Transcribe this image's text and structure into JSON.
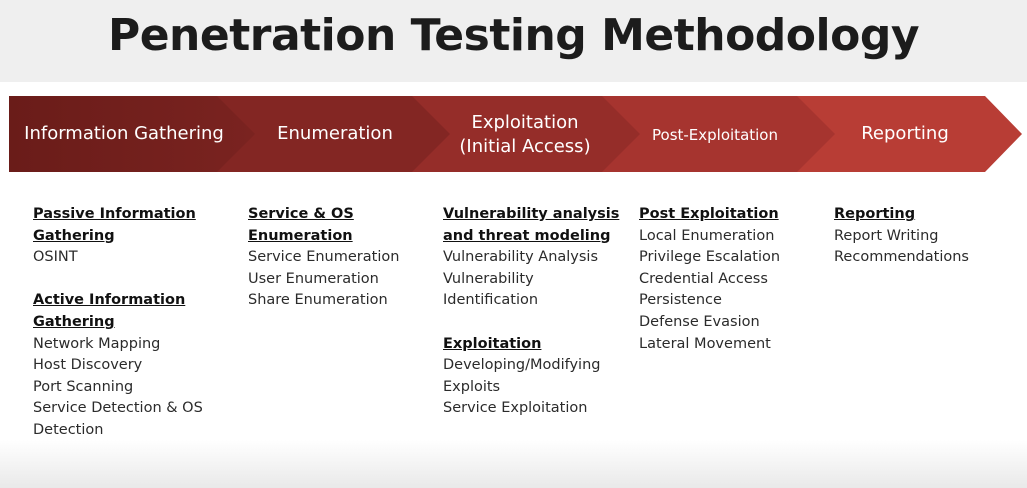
{
  "title": "Penetration Testing Methodology",
  "colors": [
    "#6e1e1b",
    "#832623",
    "#952d29",
    "#a6342f",
    "#b83d35"
  ],
  "stages": [
    {
      "label_lines": [
        "Information Gathering"
      ],
      "groups": [
        {
          "heading_lines": [
            "Passive Information",
            "Gathering"
          ],
          "items": [
            "OSINT"
          ]
        },
        {
          "heading_lines": [
            "Active Information",
            "Gathering"
          ],
          "items": [
            "Network Mapping",
            "Host Discovery",
            "Port Scanning",
            "Service Detection & OS",
            "Detection"
          ]
        }
      ]
    },
    {
      "label_lines": [
        "Enumeration"
      ],
      "groups": [
        {
          "heading_lines": [
            "Service & OS",
            "Enumeration"
          ],
          "items": [
            "Service Enumeration",
            "User Enumeration",
            "Share Enumeration"
          ]
        }
      ]
    },
    {
      "label_lines": [
        "Exploitation",
        "(Initial Access)"
      ],
      "groups": [
        {
          "heading_lines": [
            "Vulnerability analysis",
            "and threat modeling"
          ],
          "items": [
            "Vulnerability Analysis",
            "Vulnerability",
            "Identification"
          ]
        },
        {
          "heading_lines": [
            "Exploitation"
          ],
          "items": [
            "Developing/Modifying",
            "Exploits",
            "Service Exploitation"
          ]
        }
      ]
    },
    {
      "label_lines": [
        "Post-Exploitation"
      ],
      "groups": [
        {
          "heading_lines": [
            "Post Exploitation"
          ],
          "items": [
            "Local Enumeration",
            "Privilege Escalation",
            "Credential Access",
            "Persistence",
            "Defense Evasion",
            "Lateral Movement"
          ]
        }
      ]
    },
    {
      "label_lines": [
        "Reporting"
      ],
      "groups": [
        {
          "heading_lines": [
            "Reporting"
          ],
          "items": [
            "Report Writing",
            "Recommendations"
          ]
        }
      ]
    }
  ]
}
